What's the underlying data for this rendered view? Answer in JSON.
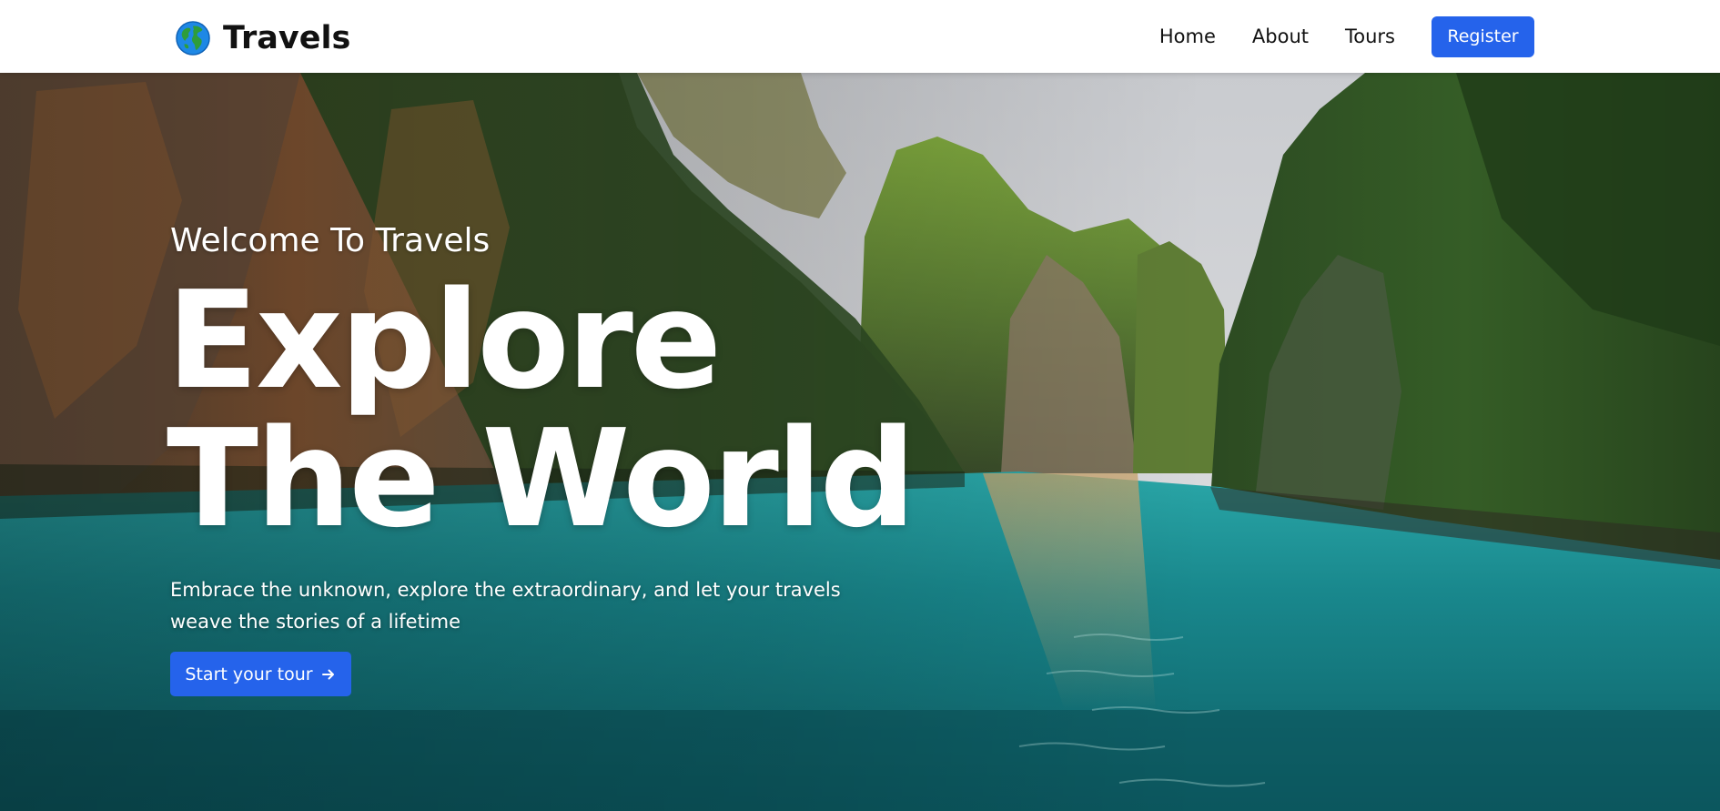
{
  "brand": {
    "name": "Travels",
    "logo_icon": "globe-icon"
  },
  "nav": {
    "links": [
      "Home",
      "About",
      "Tours"
    ],
    "register_label": "Register"
  },
  "hero": {
    "welcome": "Welcome To Travels",
    "title_line1": "Explore",
    "title_line2": "The World",
    "subtitle_line1": "Embrace the unknown, explore the extraordinary, and let your travels",
    "subtitle_line2": "weave the stories of a lifetime",
    "cta_label": "Start your tour",
    "cta_icon": "arrow-right-icon",
    "background": "tropical-lagoon-cliffs-photo"
  },
  "colors": {
    "accent": "#2563eb",
    "nav_bg": "#ffffff",
    "nav_text": "#111111",
    "hero_text": "#ffffff"
  }
}
